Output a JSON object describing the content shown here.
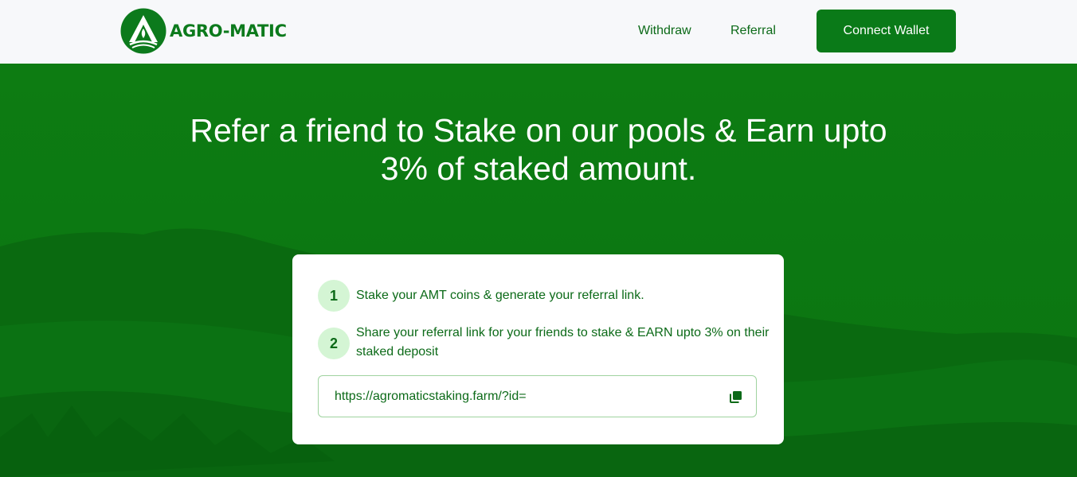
{
  "brand": {
    "name": "AGRO-MATIC",
    "logo_icon": "leaf-triangle-logo"
  },
  "nav": {
    "withdraw_label": "Withdraw",
    "referral_label": "Referral",
    "connect_label": "Connect Wallet"
  },
  "hero": {
    "title": "Refer a friend to Stake on our pools & Earn upto 3% of staked amount."
  },
  "card": {
    "steps": [
      {
        "number": "1",
        "text": "Stake your AMT coins & generate your referral link."
      },
      {
        "number": "2",
        "text": "Share your referral link for your friends to stake & EARN upto 3% on their staked deposit"
      }
    ],
    "referral_link": "https://agromaticstaking.farm/?id=",
    "copy_icon": "copy-icon"
  },
  "colors": {
    "brand_green": "#0a7a18",
    "text_green": "#0c6a18",
    "step_badge_bg": "#d4f5d4",
    "input_border": "#9fd39f"
  }
}
